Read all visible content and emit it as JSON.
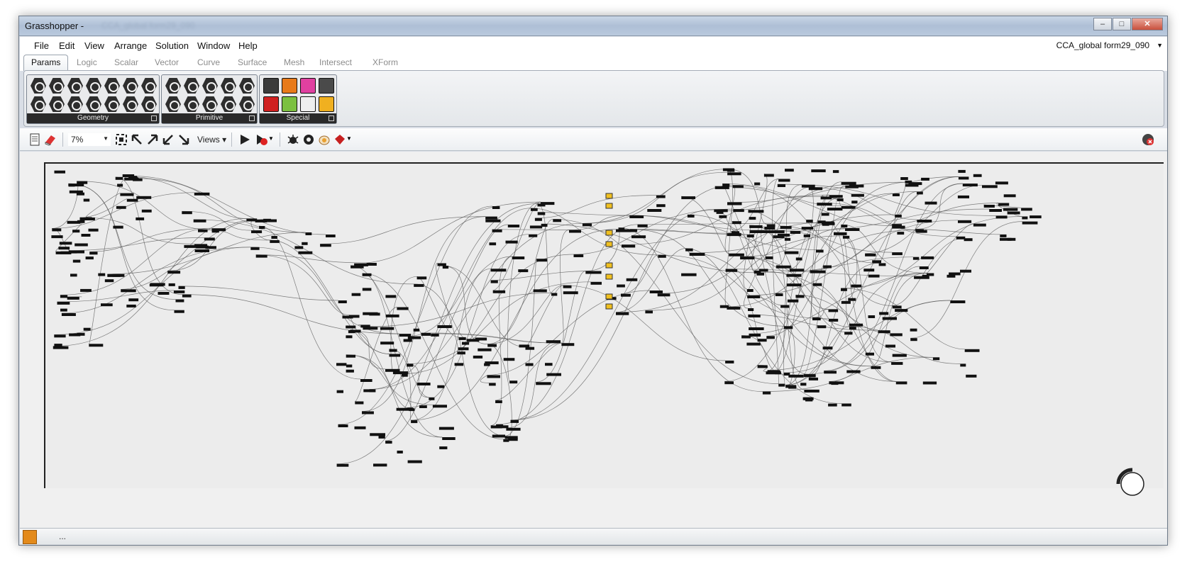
{
  "window": {
    "title": "Grasshopper -",
    "title_blurred": "CCA_global form29_090",
    "buttons": [
      "minimize",
      "maximize",
      "close"
    ]
  },
  "menu": {
    "items": [
      "File",
      "Edit",
      "View",
      "Arrange",
      "Solution",
      "Window",
      "Help"
    ],
    "document_selector": "CCA_global form29_090"
  },
  "tabs": [
    "Params",
    "Logic",
    "Scalar",
    "Vector",
    "Curve",
    "Surface",
    "Mesh",
    "Intersect",
    "XForm"
  ],
  "ribbon": {
    "groups": [
      "Geometry",
      "Primitive",
      "Special"
    ]
  },
  "toolbar": {
    "zoom": "7%",
    "views_label": "Views"
  },
  "status": {
    "text": "..."
  },
  "colors": {
    "canvas": "#ececec",
    "component": "#111111",
    "wire": "#555555",
    "panel_yellow": "#f0c020"
  },
  "icons": [
    "document-icon",
    "eraser-icon",
    "zoom-extents-icon",
    "zoom-arrow-icons",
    "play-icon",
    "record-icon",
    "bug-icon",
    "bake-icon",
    "rss-icon",
    "navigation-wheel-icon"
  ]
}
